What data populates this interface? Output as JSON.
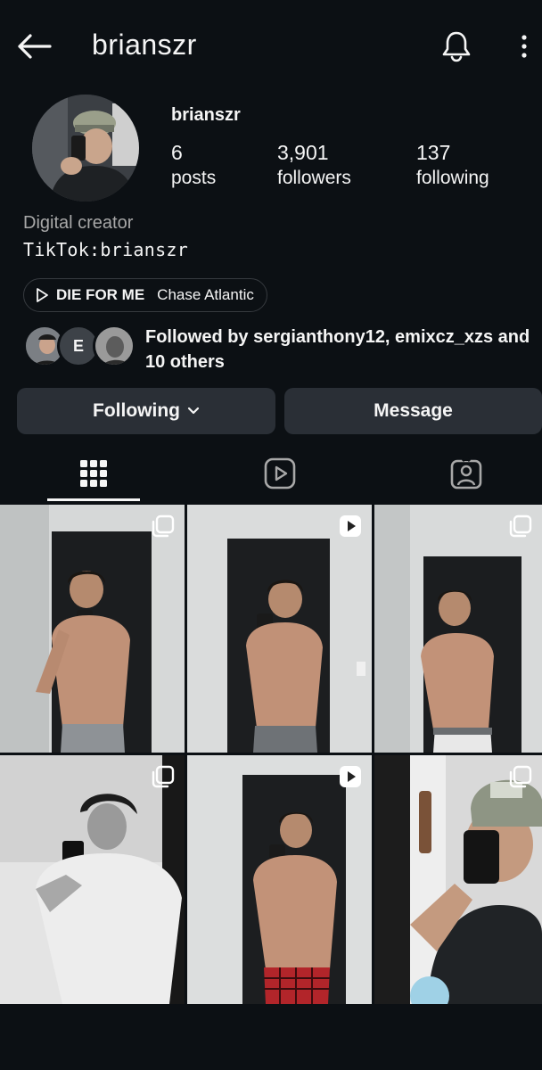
{
  "header": {
    "title": "brianszr",
    "back_icon": "arrow-left-icon",
    "notification_icon": "bell-icon",
    "more_icon": "more-vertical-icon"
  },
  "profile": {
    "name": "brianszr",
    "stats": {
      "posts_count": "6",
      "posts_label": "posts",
      "followers_count": "3,901",
      "followers_label": "followers",
      "following_count": "137",
      "following_label": "following"
    },
    "category": "Digital creator",
    "bio": "TikTok:brianszr",
    "music": {
      "song": "DIE FOR ME",
      "artist": "Chase Atlantic",
      "icon": "play-icon"
    },
    "followed_by": {
      "text": "Followed by sergianthony12, emixcz_xzs and 10 others",
      "avatar_letter": "E"
    }
  },
  "actions": {
    "following_label": "Following",
    "message_label": "Message"
  },
  "tabs": [
    "grid-icon",
    "reels-icon",
    "tagged-icon"
  ],
  "grid": {
    "posts": [
      {
        "badge": "carousel-icon"
      },
      {
        "badge": "reel-icon"
      },
      {
        "badge": "carousel-icon"
      },
      {
        "badge": "carousel-icon"
      },
      {
        "badge": "reel-icon"
      },
      {
        "badge": "carousel-icon"
      }
    ]
  },
  "colors": {
    "background": "#0c1014",
    "button": "#2a2f36",
    "text": "#f5f5f5",
    "muted": "#a8a8a8"
  }
}
